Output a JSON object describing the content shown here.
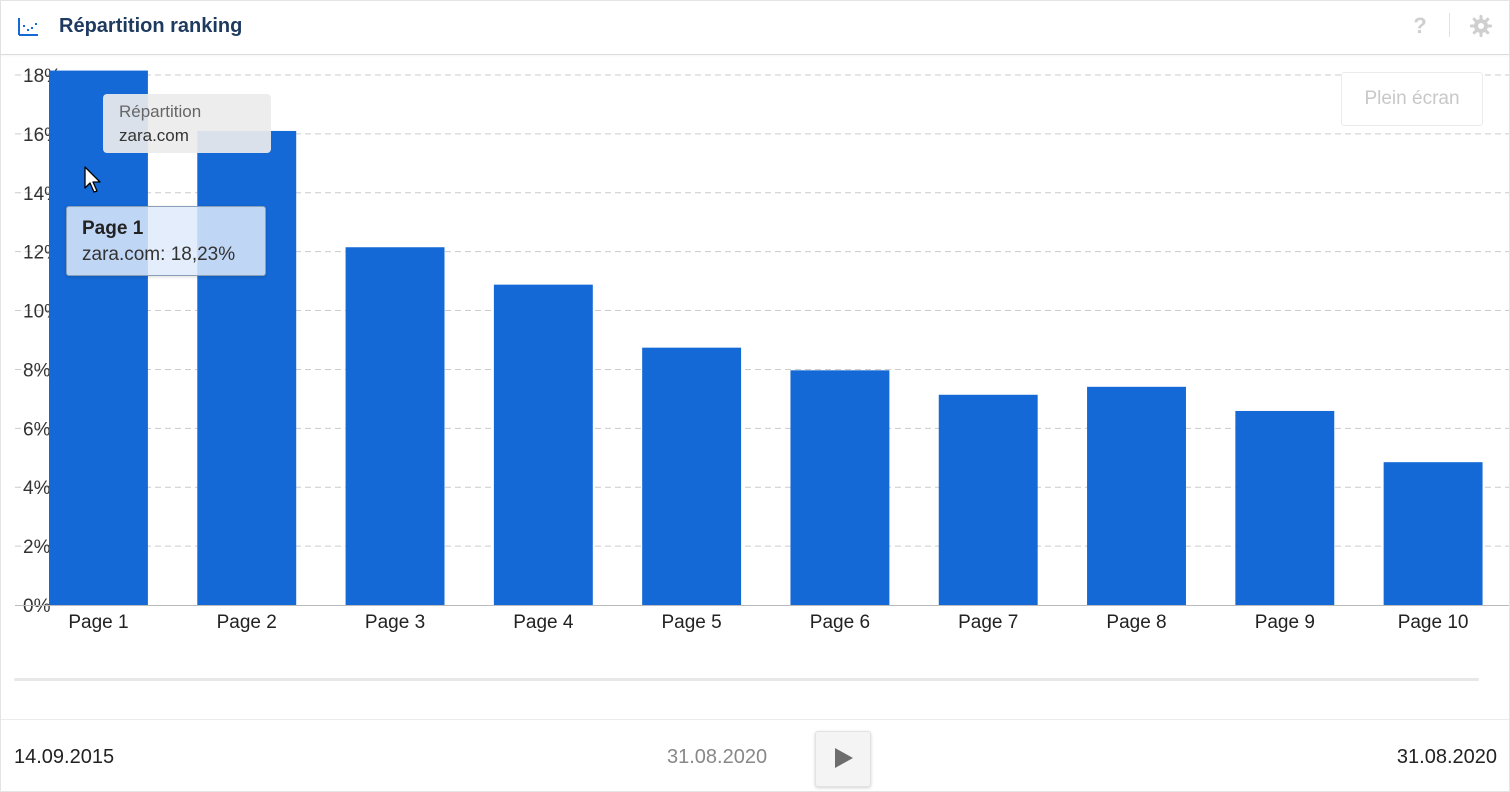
{
  "header": {
    "title": "Répartition ranking",
    "chart_icon": "bar-chart-icon",
    "help_label": "?",
    "help_icon": "help-icon",
    "settings_icon": "gear-icon"
  },
  "fullscreen_label": "Plein écran",
  "legend": {
    "title": "Répartition",
    "series": "zara.com"
  },
  "tooltip": {
    "title": "Page 1",
    "value": "zara.com: 18,23%"
  },
  "colors": {
    "bar": "#1469d6",
    "grid": "#cccccc",
    "title": "#1e3a5f"
  },
  "chart_data": {
    "type": "bar",
    "title": "Répartition ranking",
    "categories": [
      "Page 1",
      "Page 2",
      "Page 3",
      "Page 4",
      "Page 5",
      "Page 6",
      "Page 7",
      "Page 8",
      "Page 9",
      "Page 10"
    ],
    "series": [
      {
        "name": "zara.com",
        "values": [
          18.23,
          16.1,
          12.15,
          10.88,
          8.74,
          7.97,
          7.14,
          7.41,
          6.59,
          4.85
        ]
      }
    ],
    "ylim": [
      0,
      18
    ],
    "yticks": [
      0,
      2,
      4,
      6,
      8,
      10,
      12,
      14,
      16,
      18
    ],
    "ytick_labels": [
      "0%",
      "2%",
      "4%",
      "6%",
      "8%",
      "10%",
      "12%",
      "14%",
      "16%",
      "18%"
    ],
    "xlabel": "",
    "ylabel": "",
    "grid": true,
    "legend_position": "top-left"
  },
  "timeline": {
    "start_date": "14.09.2015",
    "current_date": "31.08.2020",
    "end_date": "31.08.2020",
    "play_icon": "play-icon"
  }
}
